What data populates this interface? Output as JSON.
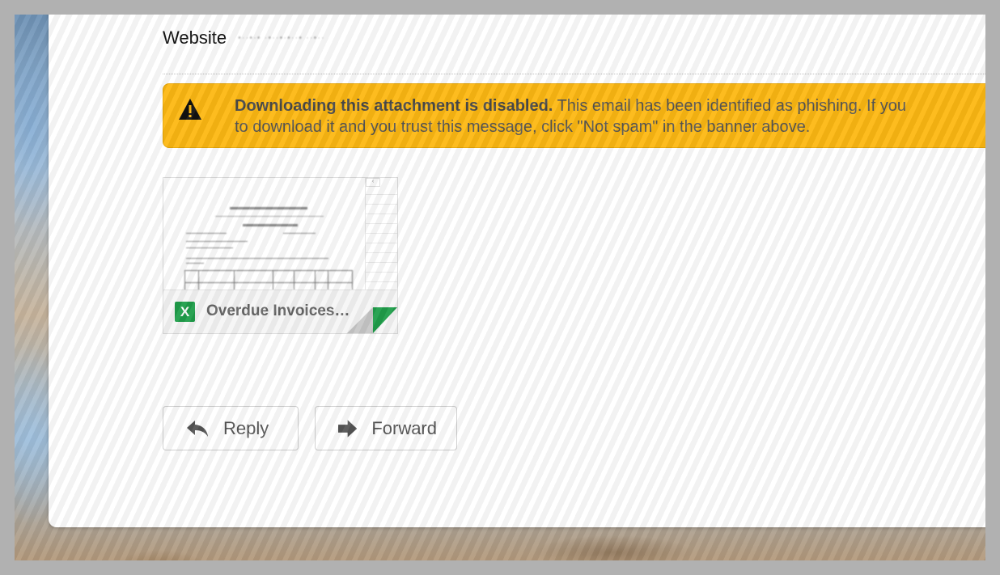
{
  "sender_info": {
    "website_label": "Website",
    "website_value": "•··•·•   ·•··•·•··•   ··•··"
  },
  "phishing_warning": {
    "icon": "warning-triangle-icon",
    "title": "Downloading this attachment is disabled.",
    "line1_rest": " This email has been identified as phishing. If you",
    "line2": "to download it and you trust this message, click \"Not spam\" in the banner above.",
    "colors": {
      "background": "#fdb813",
      "text": "#555555"
    }
  },
  "attachment": {
    "filename": "Overdue Invoices…",
    "file_type_icon": "excel-icon",
    "file_type_letter": "X",
    "preview": {
      "company": "GALAXY INTERNATIONAL TRADING LIMITED",
      "heading": "ORDER    CONFIRMATION"
    },
    "colors": {
      "excel_green": "#1f9e4a"
    }
  },
  "actions": {
    "reply_label": "Reply",
    "forward_label": "Forward"
  }
}
